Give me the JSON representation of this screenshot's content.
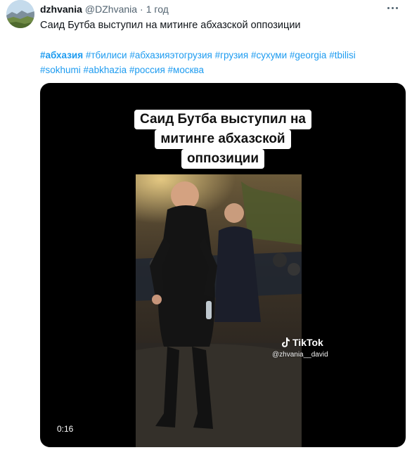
{
  "tweet": {
    "display_name": "dzhvania",
    "handle": "@DZhvania",
    "separator": "·",
    "time": "1 год",
    "text": "Саид Бутба выступил на митинге абхазской оппозиции",
    "hashtags": [
      "#абхазия",
      "#тбилиси",
      "#абхазияэтогрузия",
      "#грузия",
      "#сухуми",
      "#georgia",
      "#tbilisi",
      "#sokhumi",
      "#abkhazia",
      "#россия",
      "#москва"
    ]
  },
  "video": {
    "overlay_lines": [
      "Саид Бутба  выступил на",
      "митинге абхазской",
      "оппозиции"
    ],
    "watermark_brand": "TikTok",
    "watermark_user": "@zhvania__david",
    "duration": "0:16"
  },
  "colors": {
    "link": "#1d9bf0",
    "secondary_text": "#536471",
    "primary_text": "#0f1419",
    "media_bg": "#000000"
  },
  "icons": {
    "more": "more-horizontal-icon",
    "tiktok": "tiktok-logo-icon"
  }
}
